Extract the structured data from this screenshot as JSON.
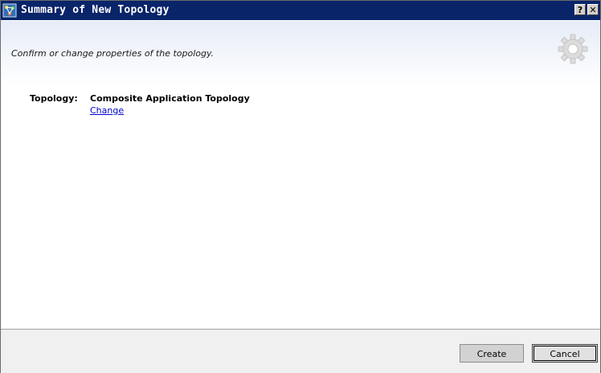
{
  "window": {
    "title": "Summary of New Topology",
    "help_label": "?",
    "close_label": "✕",
    "title_icon": "topology-app-icon"
  },
  "header": {
    "subtitle": "Confirm or change properties of the topology.",
    "decor_icon": "gear-icon"
  },
  "properties": {
    "label": "Topology:",
    "value": "Composite Application Topology",
    "change_link": "Change"
  },
  "footer": {
    "create_label": "Create",
    "cancel_label": "Cancel"
  },
  "colors": {
    "titlebar": "#0a246a",
    "link": "#0000cc",
    "header_gradient_top": "#e6ecf7"
  }
}
